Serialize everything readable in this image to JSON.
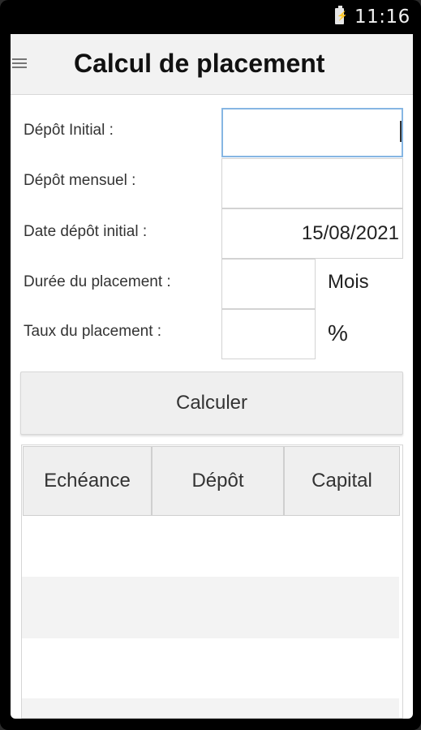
{
  "status_bar": {
    "time": "11:16",
    "battery_icon": "battery-charging-icon"
  },
  "app_bar": {
    "title": "Calcul de placement",
    "menu_icon": "hamburger-menu-icon"
  },
  "form": {
    "initial_deposit": {
      "label": "Dépôt Initial :",
      "value": ""
    },
    "monthly_deposit": {
      "label": "Dépôt mensuel :",
      "value": ""
    },
    "initial_date": {
      "label": "Date dépôt initial :",
      "value": "15/08/2021"
    },
    "duration": {
      "label": "Durée du placement :",
      "value": "",
      "unit": "Mois"
    },
    "rate": {
      "label": "Taux du placement :",
      "value": "",
      "unit": "%"
    }
  },
  "calculate_button": {
    "label": "Calculer"
  },
  "results_table": {
    "columns": [
      "Echéance",
      "Dépôt",
      "Capital"
    ],
    "rows": []
  }
}
